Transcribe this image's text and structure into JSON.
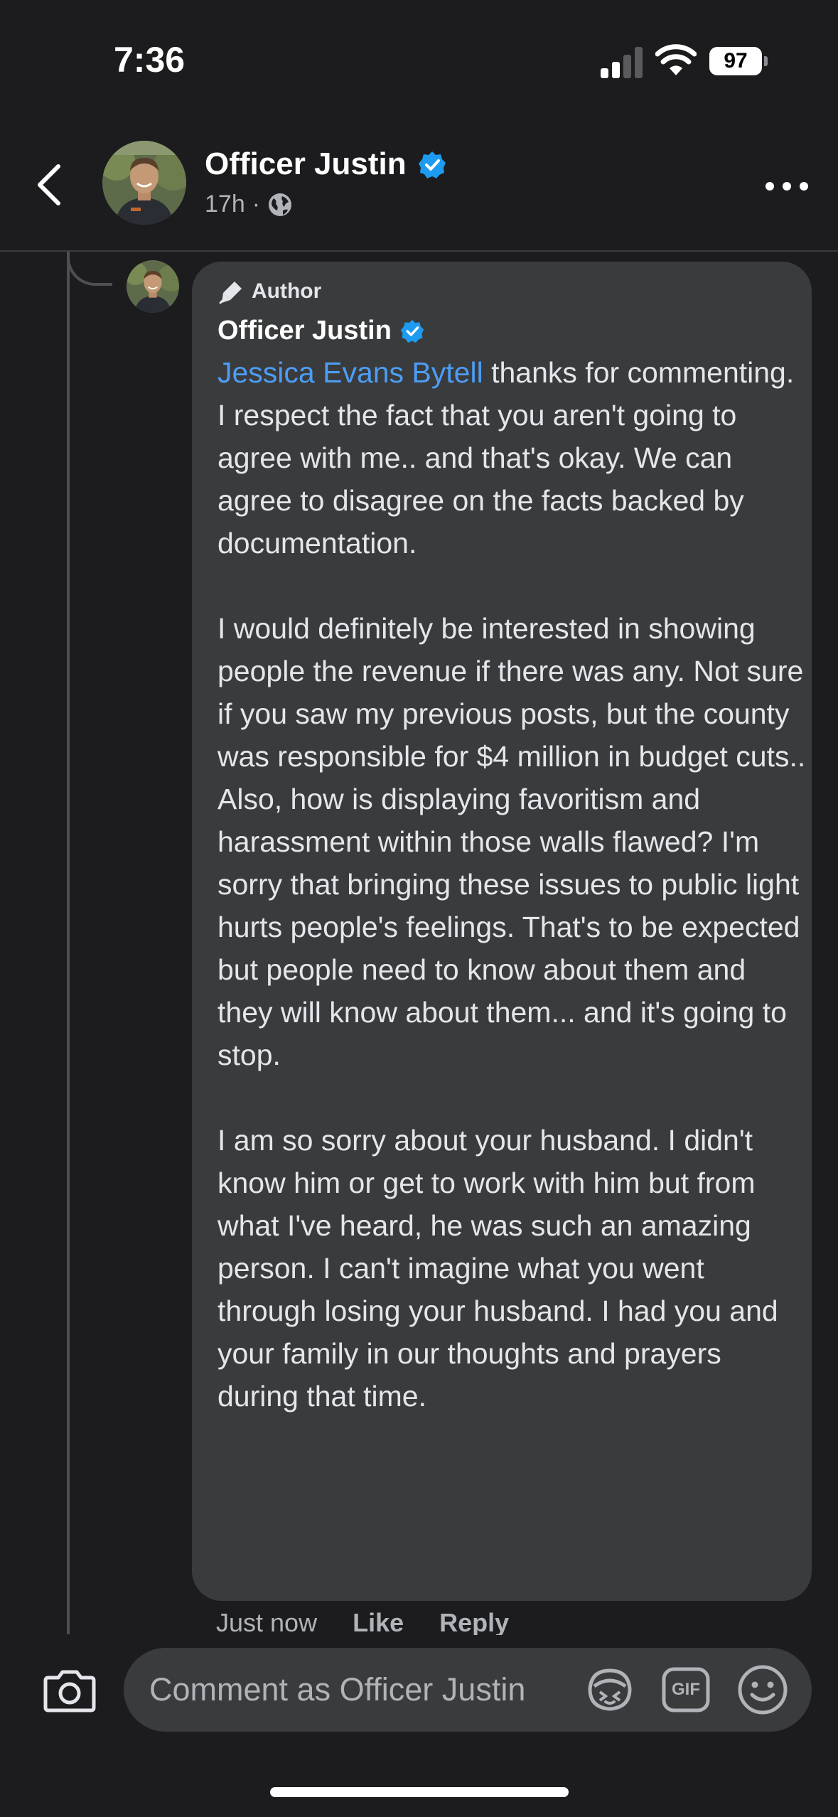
{
  "status_bar": {
    "time": "7:36",
    "battery": "97"
  },
  "header": {
    "name": "Officer Justin",
    "time_ago": "17h",
    "separator": "·",
    "icons": [
      "back-chevron-icon",
      "globe-icon",
      "verified-badge-icon",
      "more-dots-icon"
    ]
  },
  "comment": {
    "badge_label": "Author",
    "author_name": "Officer Justin",
    "mention": "Jessica Evans Bytell",
    "paragraph1_rest": " thanks for commenting. I respect the fact that you aren't going to agree with me.. and that's okay. We can agree to disagree on the facts backed by documentation.",
    "paragraph2": "I would definitely be interested in showing people the revenue if there was any. Not sure if you saw my previous posts, but the county was responsible for $4 million in budget cuts.. Also, how is displaying favoritism and harassment within those walls flawed? I'm sorry that bringing these issues to public light hurts people's feelings. That's to be expected but people need to know about them and they will know about them... and it's going to stop.",
    "paragraph3": "I am so sorry about your husband. I didn't know him or get to work with him but from what I've heard, he was such an amazing person. I can't imagine what you went through losing your husband. I had you and your family in our thoughts and prayers during that time.",
    "timestamp": "Just now",
    "like_label": "Like",
    "reply_label": "Reply"
  },
  "composer": {
    "placeholder": "Comment as Officer Justin",
    "gif_label": "GIF",
    "icons": [
      "camera-icon",
      "avatar-sticker-icon",
      "gif-icon",
      "emoji-icon"
    ]
  },
  "colors": {
    "background": "#1c1c1e",
    "bubble": "#3a3b3c",
    "mention": "#4d9df5",
    "verified": "#1d9bf0"
  }
}
